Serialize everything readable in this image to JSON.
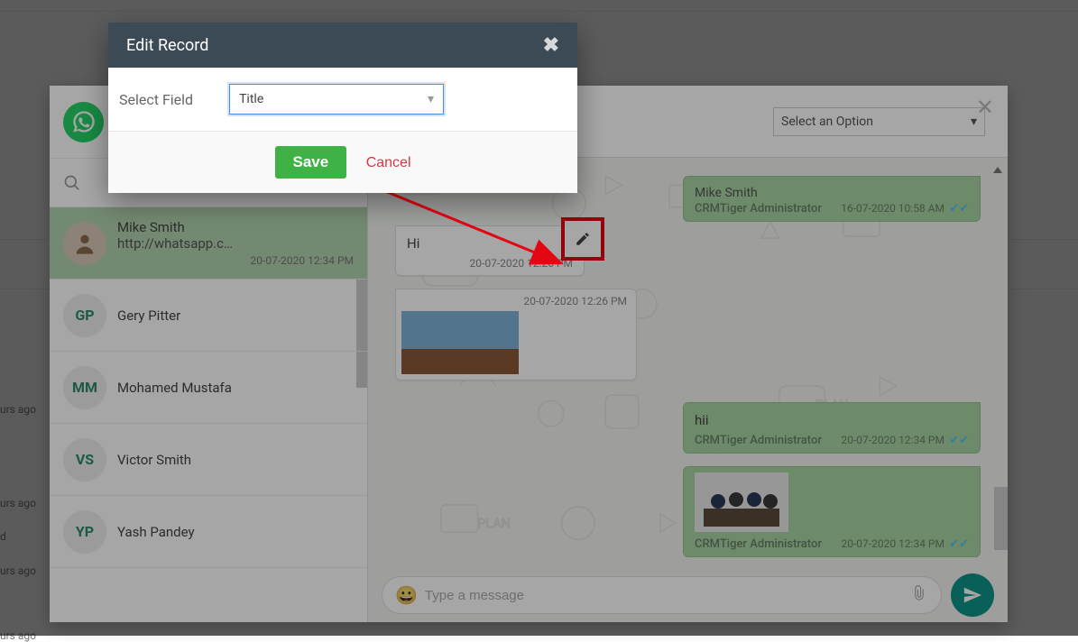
{
  "left_fragments": {
    "a": "urs ago",
    "b": "urs ago",
    "c": "d",
    "d": "urs ago",
    "e": "urs ago"
  },
  "modal": {
    "title": "Edit Record",
    "field_label": "Select Field",
    "field_value": "Title",
    "save": "Save",
    "cancel": "Cancel"
  },
  "topbar": {
    "select_placeholder": "Select an Option"
  },
  "contacts": [
    {
      "name": "Mike Smith",
      "sub": "http://whatsapp.c…",
      "time": "20-07-2020 12:34 PM",
      "initials": "",
      "selected": true,
      "avatar_img": true
    },
    {
      "name": "Gery Pitter",
      "sub": "",
      "time": "",
      "initials": "GP",
      "selected": false,
      "avatar_img": false
    },
    {
      "name": "Mohamed Mustafa",
      "sub": "",
      "time": "",
      "initials": "MM",
      "selected": false,
      "avatar_img": false
    },
    {
      "name": "Victor Smith",
      "sub": "",
      "time": "",
      "initials": "VS",
      "selected": false,
      "avatar_img": false
    },
    {
      "name": "Yash Pandey",
      "sub": "",
      "time": "",
      "initials": "YP",
      "selected": false,
      "avatar_img": false
    }
  ],
  "messages": {
    "left1": {
      "text": "Hi",
      "time": "20-07-2020 12:26 PM"
    },
    "left2": {
      "time": "20-07-2020 12:26 PM"
    },
    "right1": {
      "sender": "Mike Smith",
      "admin": "CRMTiger Administrator",
      "time": "16-07-2020 10:58 AM"
    },
    "right2": {
      "text": "hii",
      "admin": "CRMTiger Administrator",
      "time": "20-07-2020 12:34 PM"
    },
    "right3": {
      "admin": "CRMTiger Administrator",
      "time": "20-07-2020 12:34 PM"
    }
  },
  "input": {
    "placeholder": "Type a message"
  }
}
